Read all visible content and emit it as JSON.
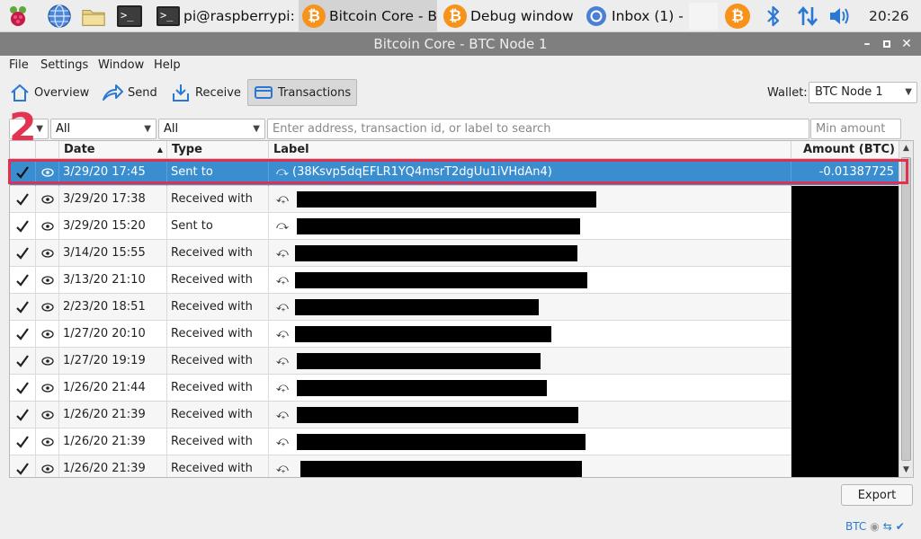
{
  "taskbar": {
    "buttons": [
      {
        "label": "pi@raspberrypi:"
      },
      {
        "label": "Bitcoin Core - B"
      },
      {
        "label": "Debug window"
      },
      {
        "label": "Inbox (1) -"
      }
    ],
    "clock": "20:26"
  },
  "window": {
    "title": "Bitcoin Core - BTC Node 1"
  },
  "menu": {
    "file": "File",
    "settings": "Settings",
    "window": "Window",
    "help": "Help"
  },
  "toolbar": {
    "overview": "Overview",
    "send": "Send",
    "receive": "Receive",
    "transactions": "Transactions",
    "wallet_label": "Wallet:",
    "wallet_value": "BTC Node 1"
  },
  "filters": {
    "date": "All",
    "type": "All",
    "search_placeholder": "Enter address, transaction id, or label to search",
    "min_amount_placeholder": "Min amount"
  },
  "table": {
    "headers": {
      "date": "Date",
      "type": "Type",
      "label": "Label",
      "amount": "Amount (BTC)"
    },
    "rows": [
      {
        "date": "3/29/20 17:45",
        "type": "Sent to",
        "label": "(38Ksvp5dqEFLR1YQ4msrT2dgUu1iVHdAn4)",
        "amount": "-0.01387725"
      },
      {
        "date": "3/29/20 17:38",
        "type": "Received with",
        "label": "",
        "amount": ""
      },
      {
        "date": "3/29/20 15:20",
        "type": "Sent to",
        "label": "",
        "amount": ""
      },
      {
        "date": "3/14/20 15:55",
        "type": "Received with",
        "label": "",
        "amount": ""
      },
      {
        "date": "3/13/20 21:10",
        "type": "Received with",
        "label": "",
        "amount": ""
      },
      {
        "date": "2/23/20 18:51",
        "type": "Received with",
        "label": "",
        "amount": ""
      },
      {
        "date": "1/27/20 20:10",
        "type": "Received with",
        "label": "",
        "amount": ""
      },
      {
        "date": "1/27/20 19:19",
        "type": "Received with",
        "label": "",
        "amount": ""
      },
      {
        "date": "1/26/20 21:44",
        "type": "Received with",
        "label": "",
        "amount": ""
      },
      {
        "date": "1/26/20 21:39",
        "type": "Received with",
        "label": "",
        "amount": ""
      },
      {
        "date": "1/26/20 21:39",
        "type": "Received with",
        "label": "",
        "amount": ""
      },
      {
        "date": "1/26/20 21:39",
        "type": "Received with",
        "label": "",
        "amount": ""
      }
    ]
  },
  "annotation": "2",
  "export_label": "Export",
  "status_unit": "BTC",
  "colors": {
    "selection": "#3a8ed0",
    "annotation": "#e23350",
    "bitcoin": "#f7931a"
  }
}
